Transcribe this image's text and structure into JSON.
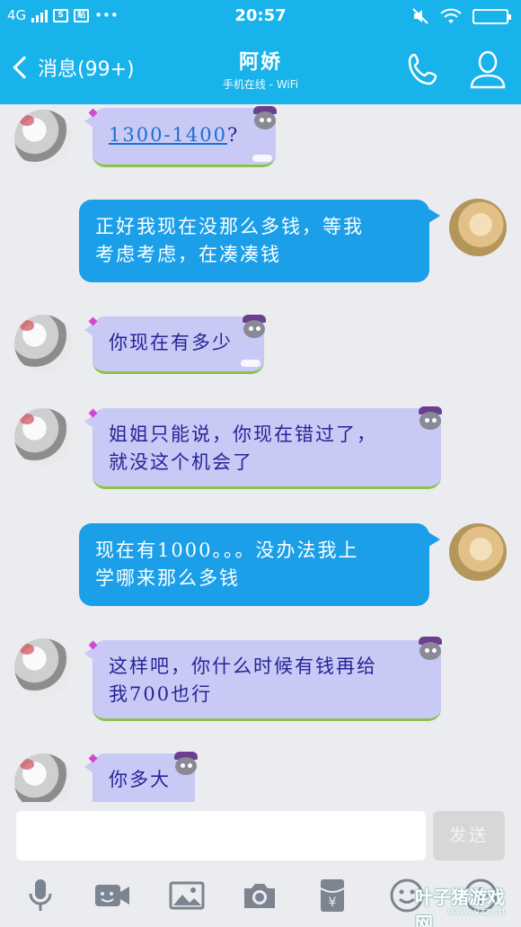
{
  "status_bar": {
    "network": "4G",
    "time": "20:57",
    "more_glyph": "•••",
    "box_icon_1": "S",
    "box_icon_2": "贴"
  },
  "header": {
    "back_label": "消息(99+)",
    "contact_name": "阿娇",
    "contact_status": "手机在线 - WiFi",
    "bar_color": "#18b3ea"
  },
  "messages": [
    {
      "from": "her",
      "text": "1300-1400",
      "suffix": "?"
    },
    {
      "from": "me",
      "lines": [
        "正好我现在没那么多钱，等我",
        "考虑考虑，在凑凑钱"
      ]
    },
    {
      "from": "her",
      "lines": [
        "你现在有多少"
      ]
    },
    {
      "from": "her",
      "lines": [
        "姐姐只能说，你现在错过了，",
        "就没这个机会了"
      ]
    },
    {
      "from": "me",
      "lines": [
        "现在有1000。。。没办法我上",
        "学哪来那么多钱"
      ]
    },
    {
      "from": "her",
      "lines": [
        "这样吧，你什么时候有钱再给",
        "我700也行"
      ]
    },
    {
      "from": "her",
      "lines": [
        "你多大"
      ]
    }
  ],
  "composer": {
    "input_value": "",
    "send_label": "发送"
  },
  "toolbar": {
    "icons": [
      "microphone-icon",
      "video-icon",
      "image-icon",
      "camera-icon",
      "red-packet-icon",
      "emoji-icon",
      "plus-icon"
    ]
  },
  "watermark": {
    "text": "叶子猪游戏网",
    "url": "www.yzz.cn"
  },
  "colors": {
    "her_bubble": "#c9c9f6",
    "her_text": "#252597",
    "my_bubble": "#1a9fe8"
  }
}
